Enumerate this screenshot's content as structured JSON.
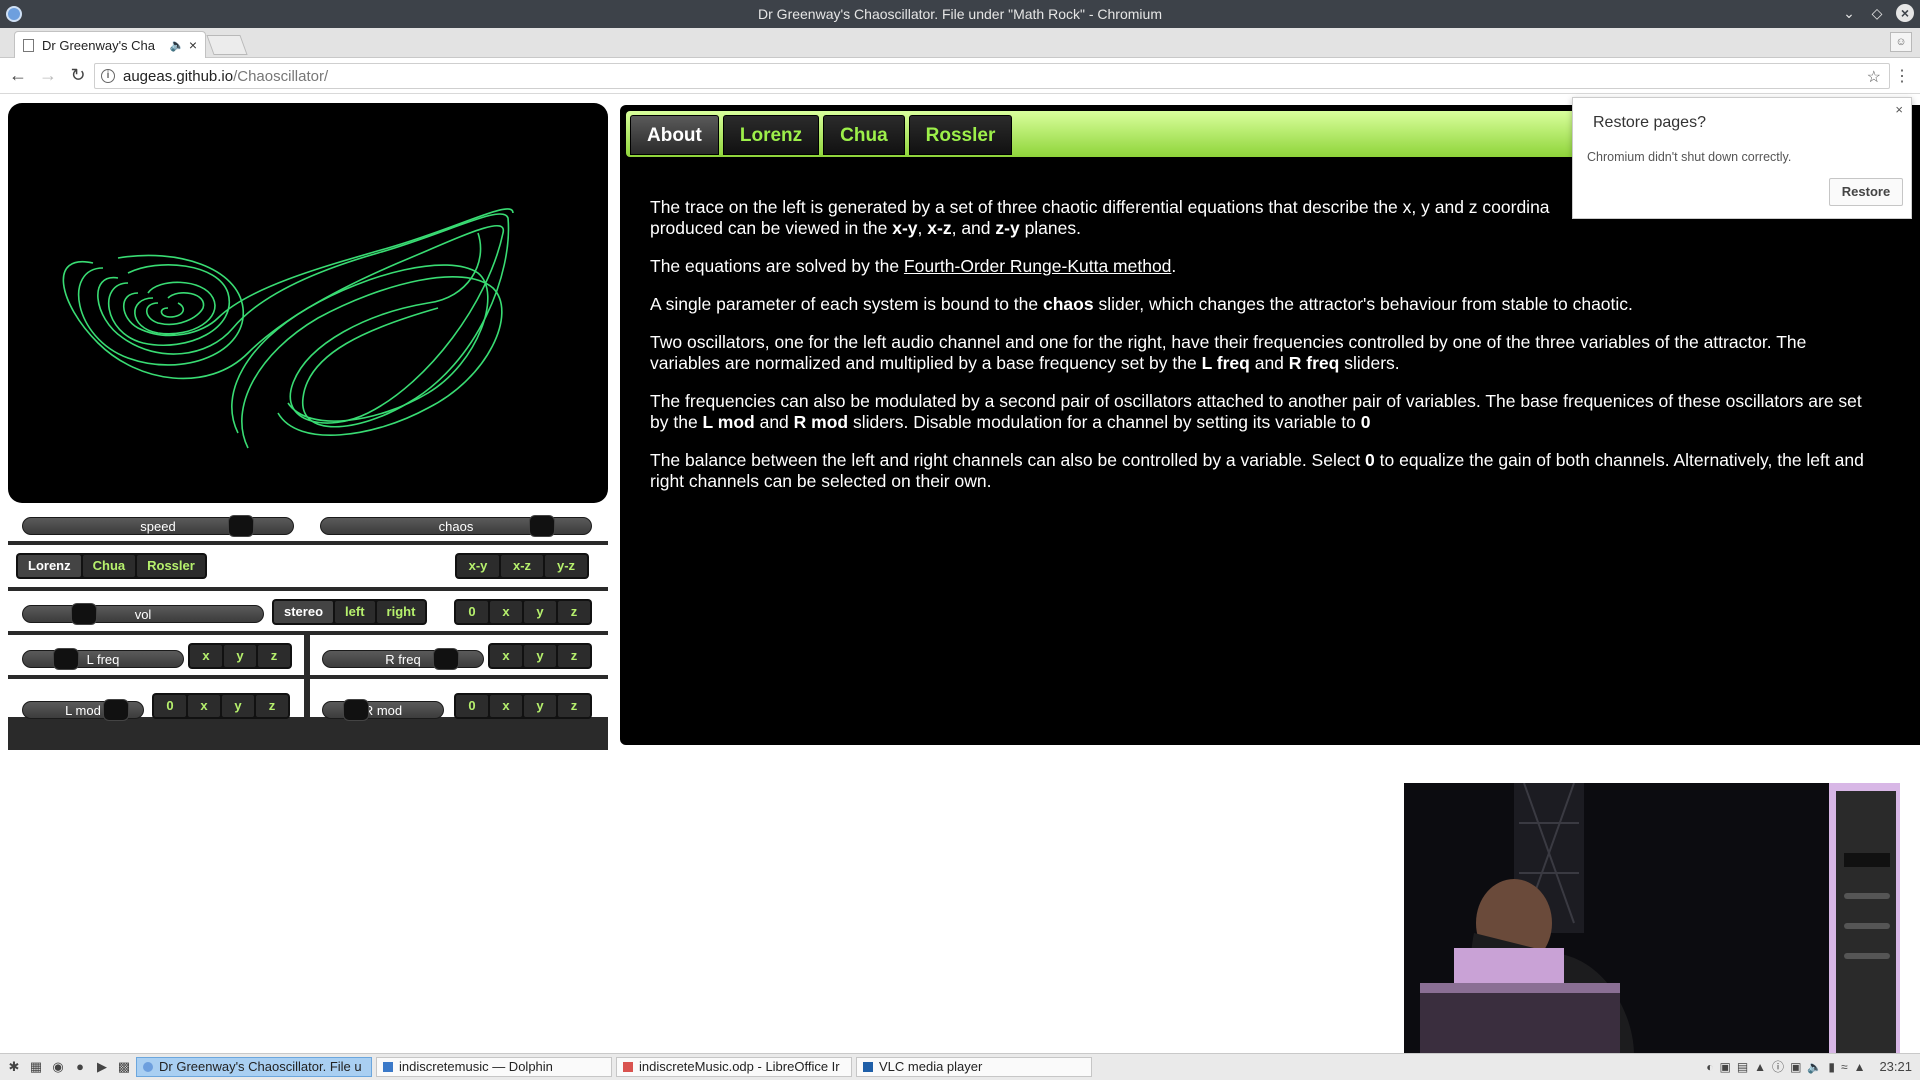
{
  "window": {
    "title": "Dr Greenway's Chaoscillator. File under \"Math Rock\" - Chromium"
  },
  "browser": {
    "tab_title": "Dr Greenway's Cha",
    "url_host": "augeas.github.io",
    "url_path": "/Chaoscillator/"
  },
  "popup": {
    "title": "Restore pages?",
    "message": "Chromium didn't shut down correctly.",
    "button": "Restore"
  },
  "controls": {
    "speed": {
      "label": "speed",
      "value": 0.78
    },
    "chaos": {
      "label": "chaos",
      "value": 0.81
    },
    "systems": [
      "Lorenz",
      "Chua",
      "Rossler"
    ],
    "system_selected": "Lorenz",
    "planes": [
      "x-y",
      "x-z",
      "y-z"
    ],
    "vol": {
      "label": "vol",
      "value": 0.25
    },
    "channels": [
      "stereo",
      "left",
      "right"
    ],
    "channel_selected": "stereo",
    "balance_vars": [
      "0",
      "x",
      "y",
      "z"
    ],
    "lfreq": {
      "label": "L freq",
      "value": 0.2,
      "vars": [
        "x",
        "y",
        "z"
      ]
    },
    "rfreq": {
      "label": "R freq",
      "value": 0.75,
      "vars": [
        "x",
        "y",
        "z"
      ]
    },
    "lmod": {
      "label": "L mod",
      "value": 0.74,
      "vars": [
        "0",
        "x",
        "y",
        "z"
      ]
    },
    "rmod": {
      "label": "R mod",
      "value": 0.27,
      "vars": [
        "0",
        "x",
        "y",
        "z"
      ]
    }
  },
  "info": {
    "tabs": [
      "About",
      "Lorenz",
      "Chua",
      "Rossler"
    ],
    "active_tab": "About",
    "p1a": "The trace on the left is generated by a set of three chaotic differential equations that describe the x, y and z coordina",
    "p1b": "produced can be viewed in the ",
    "p1_xy": "x-y",
    "p1_sep1": ", ",
    "p1_xz": "x-z",
    "p1_sep2": ", and ",
    "p1_zy": "z-y",
    "p1_end": " planes.",
    "p2a": "The equations are solved by the ",
    "p2_link": "Fourth-Order Runge-Kutta method",
    "p2b": ".",
    "p3a": "A single parameter of each system is bound to the ",
    "p3_b": "chaos",
    "p3b": " slider, which changes the attractor's behaviour from stable to chaotic.",
    "p4a": "Two oscillators, one for the left audio channel and one for the right, have their frequencies controlled by one of the three variables of the attractor. The variables are normalized and multiplied by a base frequency set by the ",
    "p4_b1": "L freq",
    "p4_mid": " and ",
    "p4_b2": "R freq",
    "p4b": " sliders.",
    "p5a": "The frequencies can also be modulated by a second pair of oscillators attached to another pair of variables. The base frequenices of these oscillators are set by the ",
    "p5_b1": "L mod",
    "p5_mid": " and ",
    "p5_b2": "R mod",
    "p5b": " sliders. Disable modulation for a channel by setting its variable to ",
    "p5_b3": "0",
    "p6a": "The balance between the left and right channels can also be controlled by a variable. Select ",
    "p6_b": "0",
    "p6b": " to equalize the gain of both channels. Alternatively, the left and right channels can be selected on their own."
  },
  "taskbar": {
    "tasks": [
      "Dr Greenway's Chaoscillator. File u",
      "indiscretemusic — Dolphin",
      "indiscreteMusic.odp - LibreOffice Ir",
      "VLC media player"
    ],
    "clock": "23:21"
  },
  "colors": {
    "trace": "#3de87a",
    "accent": "#9df04a",
    "panel": "#000000"
  }
}
